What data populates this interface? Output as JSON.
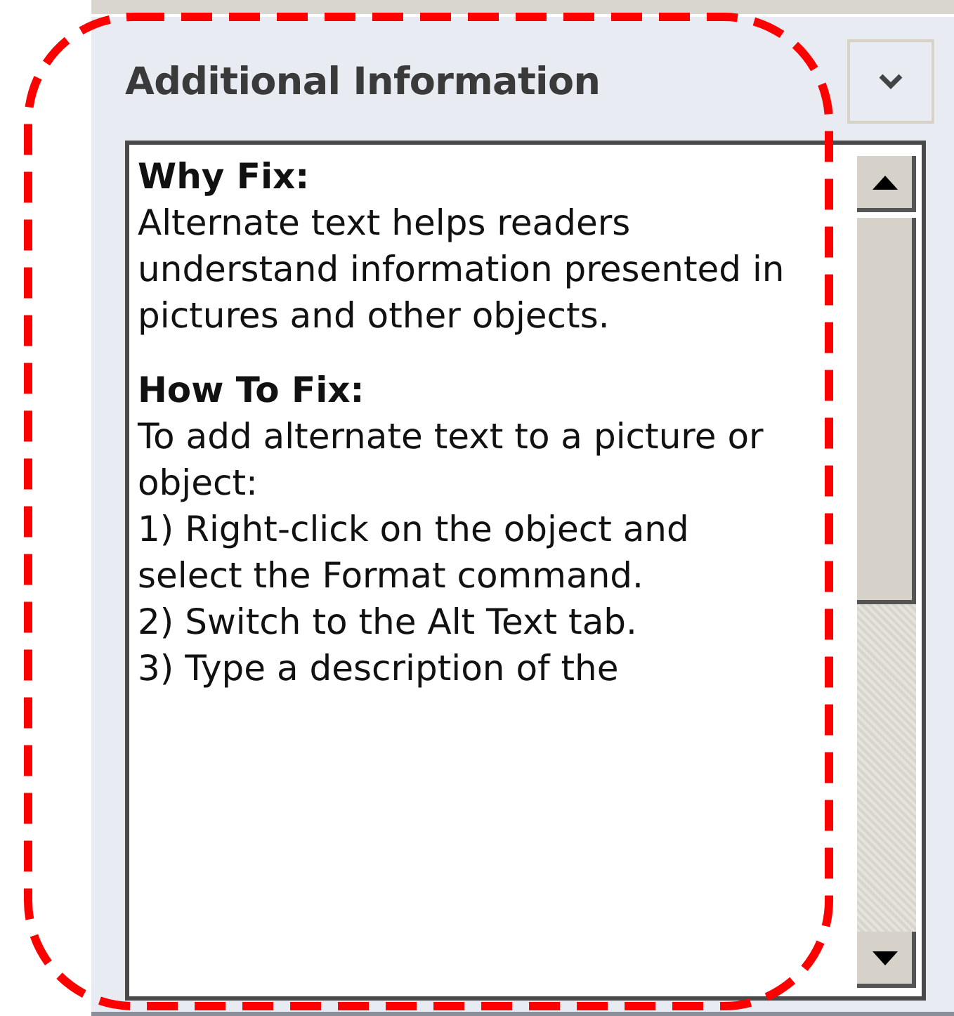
{
  "panel": {
    "title": "Additional Information"
  },
  "content": [
    {
      "kind": "heading",
      "text": "Why Fix:"
    },
    {
      "kind": "paragraph",
      "text": "Alternate text helps readers understand information presented in pictures and other objects."
    },
    {
      "kind": "heading",
      "text": "How To Fix:"
    },
    {
      "kind": "line",
      "text": "To add alternate text to a picture or object:"
    },
    {
      "kind": "line",
      "text": "1) Right-click on the object and select the Format command."
    },
    {
      "kind": "line",
      "text": "2) Switch to the Alt Text tab."
    },
    {
      "kind": "line",
      "text": "3) Type a description of the"
    }
  ]
}
